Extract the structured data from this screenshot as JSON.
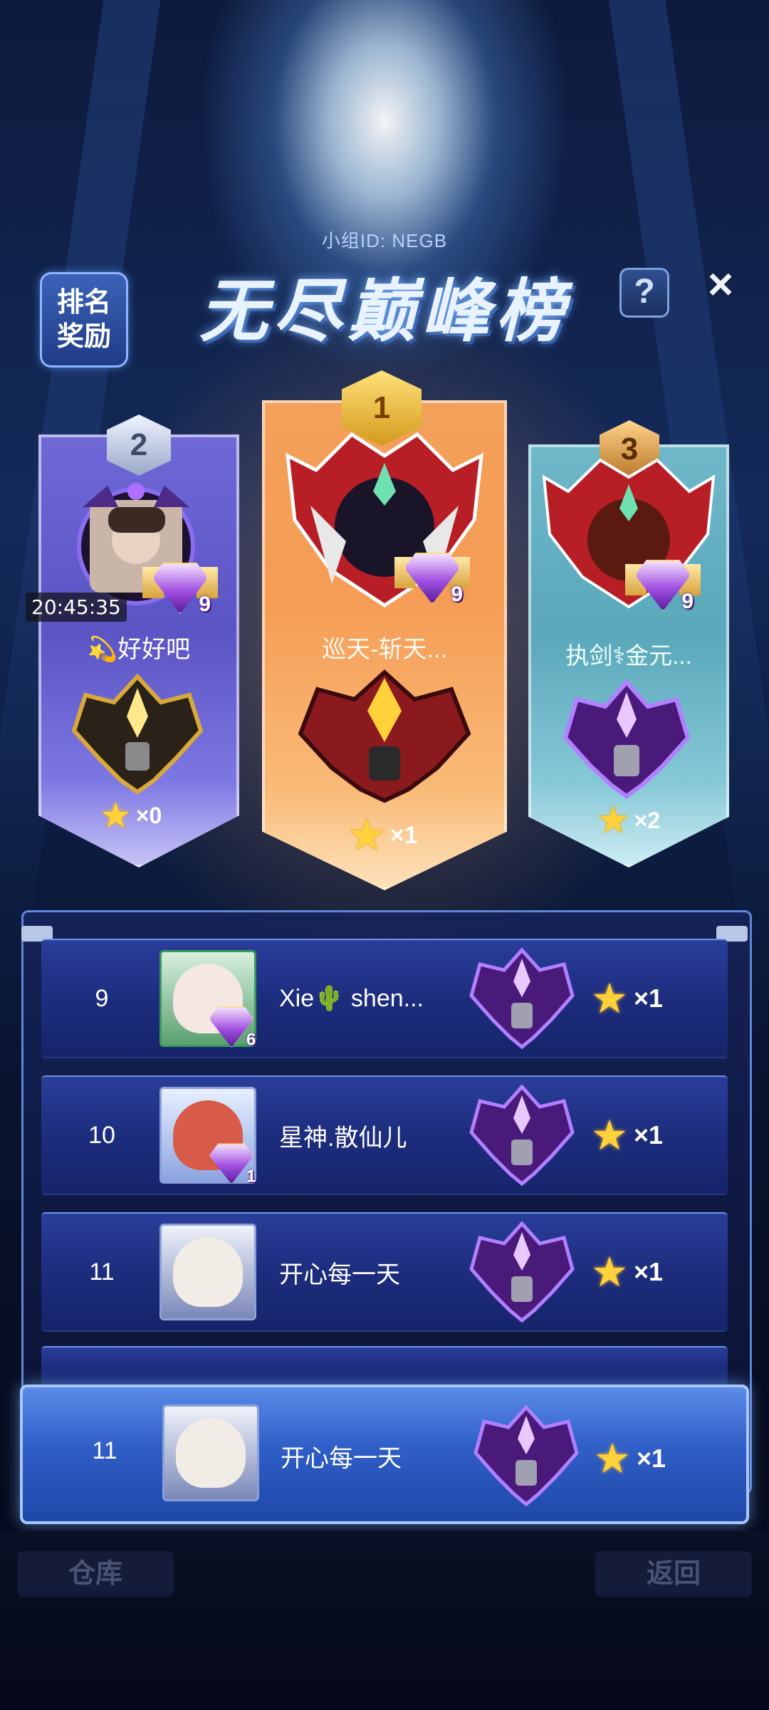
{
  "header": {
    "group_id": "小组ID: NEGB",
    "title": "无尽巅峰榜",
    "rank_reward_line1": "排名",
    "rank_reward_line2": "奖励",
    "help_icon": "?",
    "close_icon": "×"
  },
  "status": {
    "timestamp": "20:45:35"
  },
  "podium": [
    {
      "place": "1",
      "name": "巡天-斩天...",
      "tier": "9",
      "stars": "×1",
      "reward_icon": "red-gold-armor-icon"
    },
    {
      "place": "2",
      "name": "💫好好吧",
      "tier": "9",
      "stars": "×0",
      "reward_icon": "gold-armor-icon"
    },
    {
      "place": "3",
      "name": "执剑⚕金元...",
      "tier": "9",
      "stars": "×2",
      "reward_icon": "purple-armor-icon"
    }
  ],
  "list": [
    {
      "rank": "9",
      "name": "Xie🌵 shen...",
      "tier": "6",
      "stars": "×1"
    },
    {
      "rank": "10",
      "name": "星神.散仙儿",
      "tier": "1",
      "stars": "×1"
    },
    {
      "rank": "11",
      "name": "开心每一天",
      "tier": "",
      "stars": "×1"
    }
  ],
  "self_row": {
    "rank": "11",
    "name": "开心每一天",
    "stars": "×1"
  },
  "bottom": {
    "left_button": "仓库",
    "right_button": "返回"
  },
  "colors": {
    "gold": "#ffd23b",
    "first": "#f59c55",
    "second": "#5a54c4",
    "third": "#5aa8bb",
    "list_row": "#1d2d7e"
  }
}
